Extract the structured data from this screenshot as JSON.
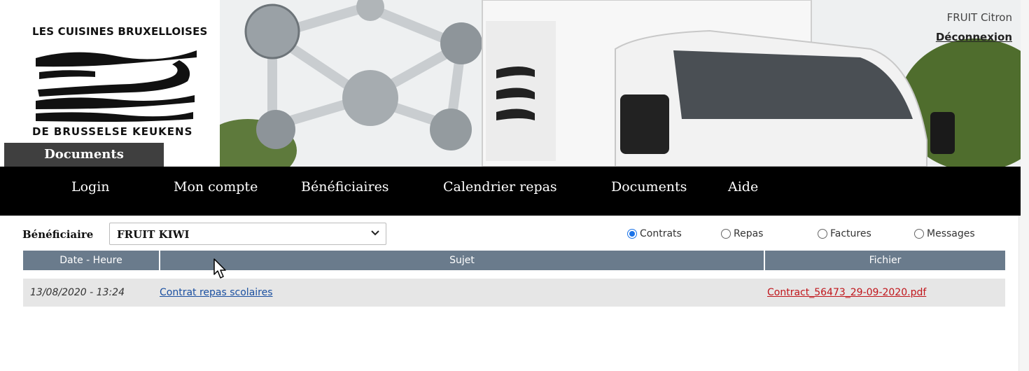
{
  "header": {
    "logo_top": "LES CUISINES BRUXELLOISES",
    "logo_bottom": "DE BRUSSELSE KEUKENS",
    "section_label": "Documents",
    "user_name": "FRUIT Citron",
    "logout_label": "Déconnexion"
  },
  "nav": {
    "items": [
      "Login",
      "Mon compte",
      "Bénéficiaires",
      "Calendrier repas",
      "Documents",
      "Aide"
    ]
  },
  "filters": {
    "beneficiary_label": "Bénéficiaire",
    "beneficiary_value": "FRUIT KIWI",
    "radios": [
      {
        "label": "Contrats",
        "checked": true
      },
      {
        "label": "Repas",
        "checked": false
      },
      {
        "label": "Factures",
        "checked": false
      },
      {
        "label": "Messages",
        "checked": false
      }
    ]
  },
  "table": {
    "headers": [
      "Date - Heure",
      "Sujet",
      "Fichier"
    ],
    "rows": [
      {
        "date": "13/08/2020 - 13:24",
        "subject": "Contrat repas scolaires",
        "file": "Contract_56473_29-09-2020.pdf"
      }
    ]
  },
  "colors": {
    "nav_bg": "#000000",
    "table_header": "#6a7b8c",
    "link": "#1a4fa0",
    "file_link": "#c0151b",
    "radio_accent": "#1a73e8"
  }
}
